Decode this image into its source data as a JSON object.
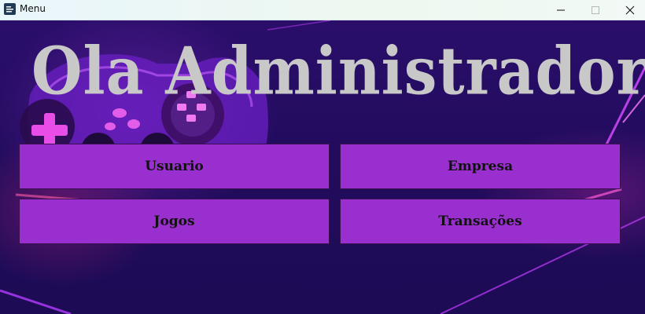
{
  "window": {
    "title": "Menu",
    "icon": "app-icon"
  },
  "window_controls": {
    "minimize": "minimize-icon",
    "maximize": "maximize-icon",
    "close": "close-icon"
  },
  "headline": "Ola Administrador!",
  "menu": {
    "usuario": "Usuario",
    "empresa": "Empresa",
    "jogos": "Jogos",
    "transacoes": "Transações"
  },
  "colors": {
    "background": "#220c5e",
    "button_fill": "#9a2fcf",
    "headline_text": "#c8c8c8",
    "neon": "#c23cff"
  }
}
